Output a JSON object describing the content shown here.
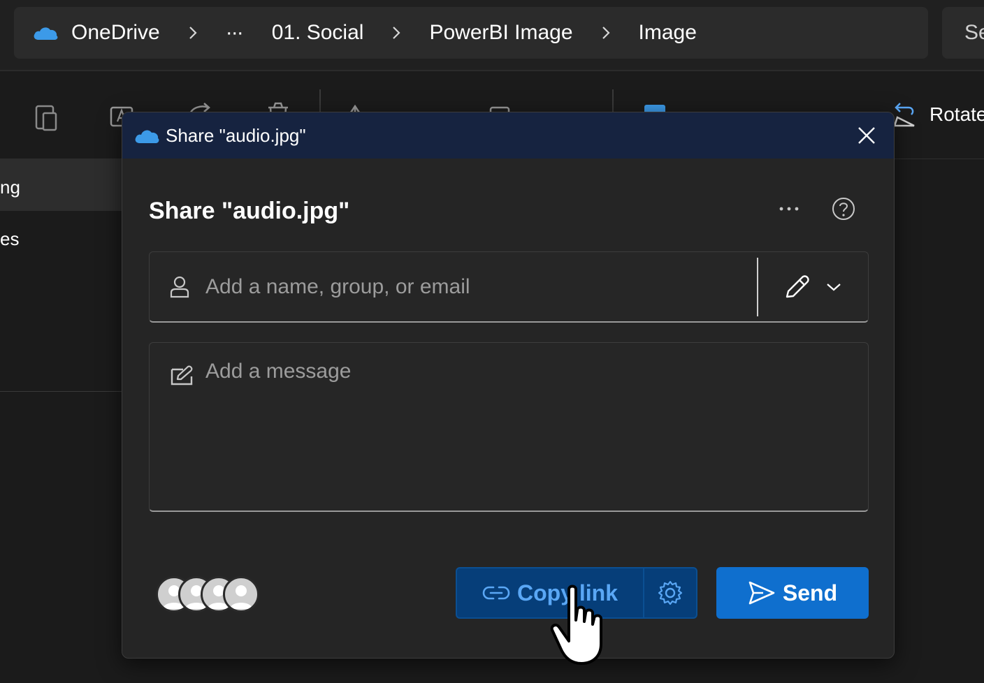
{
  "address_bar": {
    "crumbs": [
      "OneDrive",
      "01. Social",
      "PowerBI Image",
      "Image"
    ],
    "overflow": "···",
    "search_text": "Se"
  },
  "toolbar": {
    "rotate_label": "Rotate"
  },
  "left_nav": {
    "item1": "ng",
    "item2": "es"
  },
  "dialog": {
    "window_title": "Share \"audio.jpg\"",
    "heading": "Share \"audio.jpg\"",
    "more_label": "···",
    "people_placeholder": "Add a name, group, or email",
    "message_placeholder": "Add a message",
    "copy_link_label": "Copy link",
    "send_label": "Send"
  },
  "colors": {
    "accent": "#0f6fce",
    "copy_bg": "#063e79",
    "copy_text": "#5aa7f5",
    "titlebar": "#162340"
  },
  "icons": [
    "onedrive-cloud-icon",
    "chevron-right-icon",
    "more-icon",
    "help-icon",
    "close-icon",
    "person-icon",
    "pencil-icon",
    "chevron-down-icon",
    "compose-icon",
    "link-icon",
    "gear-icon",
    "send-icon",
    "rotate-icon",
    "hand-cursor-icon"
  ]
}
